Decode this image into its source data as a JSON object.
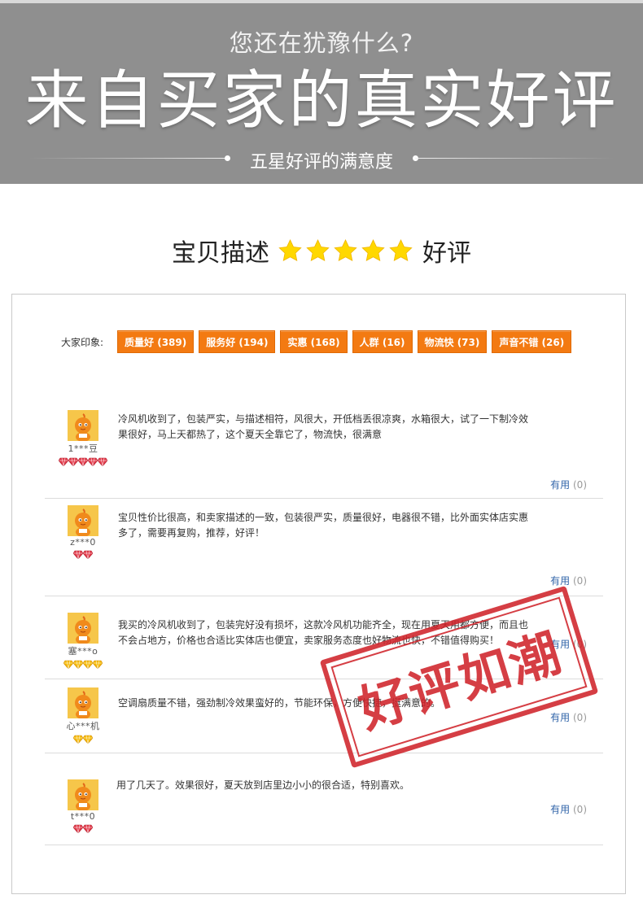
{
  "banner": {
    "subtitle": "您还在犹豫什么?",
    "title": "来自买家的真实好评",
    "tagline": "五星好评的满意度"
  },
  "rating": {
    "label": "宝贝描述",
    "stars": 5,
    "verdict": "好评"
  },
  "impressions": {
    "label": "大家印象:",
    "tags": [
      {
        "text": "质量好 (389)"
      },
      {
        "text": "服务好 (194)"
      },
      {
        "text": "实惠 (168)"
      },
      {
        "text": "人群 (16)"
      },
      {
        "text": "物流快 (73)"
      },
      {
        "text": "声音不错 (26)"
      }
    ]
  },
  "reviews": [
    {
      "user": "1***豆",
      "level_icons": 5,
      "level_icon": "red-heart-diamond-icon",
      "text": "冷风机收到了，包装严实，与描述相符，风很大，开低档丢很凉爽，水箱很大，试了一下制冷效果很好，马上天都热了，这个夏天全靠它了，物流快，很满意",
      "useful_label": "有用",
      "useful_count": "(0)"
    },
    {
      "user": "z***0",
      "level_icons": 2,
      "level_icon": "red-heart-diamond-icon",
      "text": "宝贝性价比很高，和卖家描述的一致，包装很严实，质量很好，电器很不错，比外面实体店实惠多了，需要再复购，推荐，好评！",
      "useful_label": "有用",
      "useful_count": "(0)"
    },
    {
      "user": "塞***o",
      "level_icons": 4,
      "level_icon": "yellow-diamond-icon",
      "text": "我买的冷风机收到了，包装完好没有损坏，这款冷风机功能齐全，现在用夏天用都方便，而且也不会占地方，价格也合适比实体店也便宜，卖家服务态度也好物流也快，不错值得购买！",
      "useful_label": "有用",
      "useful_count": "(0)"
    },
    {
      "user": "心***机",
      "level_icons": 2,
      "level_icon": "yellow-diamond-icon",
      "text": "空调扇质量不错，强劲制冷效果蛮好的，节能环保，方便快捷，挺满意的。",
      "useful_label": "有用",
      "useful_count": "(0)"
    },
    {
      "user": "t***0",
      "level_icons": 2,
      "level_icon": "red-heart-diamond-icon",
      "text": "用了几天了。效果很好，夏天放到店里边小小的很合适，特别喜欢。",
      "useful_label": "有用",
      "useful_count": "(0)"
    }
  ],
  "stamp": {
    "text": "好评如潮"
  },
  "colors": {
    "banner_bg": "#8f8f8f",
    "tag_bg": "#f37a12",
    "star": "#ffd800",
    "stamp": "#d0242b",
    "useful_link": "#3366aa"
  }
}
